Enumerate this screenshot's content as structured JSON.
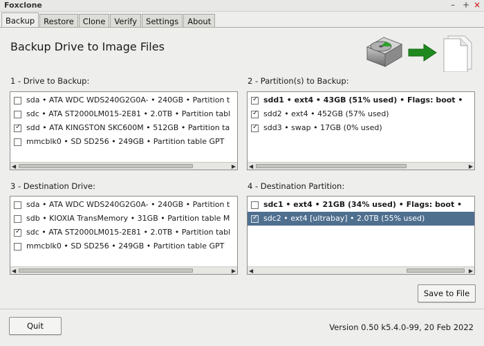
{
  "window": {
    "title": "Foxclone"
  },
  "tabs": [
    {
      "label": "Backup"
    },
    {
      "label": "Restore"
    },
    {
      "label": "Clone"
    },
    {
      "label": "Verify"
    },
    {
      "label": "Settings"
    },
    {
      "label": "About"
    }
  ],
  "page": {
    "heading": "Backup Drive to Image Files"
  },
  "drive_to_backup": {
    "label": "1 - Drive to Backup:",
    "items": [
      {
        "text": "sda • ATA WDC WDS240G2G0A- • 240GB • Partition t",
        "checked": false
      },
      {
        "text": "sdc • ATA ST2000LM015-2E81 • 2.0TB • Partition tabl",
        "checked": false
      },
      {
        "text": "sdd • ATA KINGSTON SKC600M • 512GB • Partition ta",
        "checked": true
      },
      {
        "text": "mmcblk0 • SD SD256 • 249GB • Partition table GPT",
        "checked": false
      }
    ]
  },
  "partitions_to_backup": {
    "label": "2 - Partition(s) to Backup:",
    "items": [
      {
        "text": "sdd1 • ext4 • 43GB (51% used) • Flags: boot •",
        "checked": true
      },
      {
        "text": "sdd2 • ext4 • 452GB (57% used)",
        "checked": true
      },
      {
        "text": "sdd3 • swap • 17GB (0% used)",
        "checked": true
      }
    ]
  },
  "destination_drive": {
    "label": "3 - Destination Drive:",
    "items": [
      {
        "text": "sda • ATA WDC WDS240G2G0A- • 240GB • Partition t",
        "checked": false
      },
      {
        "text": "sdb • KIOXIA TransMemory • 31GB • Partition table M",
        "checked": false
      },
      {
        "text": "sdc • ATA ST2000LM015-2E81 • 2.0TB • Partition tabl",
        "checked": true
      },
      {
        "text": "mmcblk0 • SD SD256 • 249GB • Partition table GPT",
        "checked": false
      }
    ]
  },
  "destination_partition": {
    "label": "4 - Destination Partition:",
    "items": [
      {
        "text": "sdc1 • ext4 • 21GB (34% used) • Flags: boot •",
        "checked": false
      },
      {
        "text": "sdc2 • ext4 [ultrabay] • 2.0TB (55% used)",
        "checked": true
      }
    ]
  },
  "buttons": {
    "save_to_file": "Save to File",
    "quit": "Quit"
  },
  "footer": {
    "version": "Version 0.50 k5.4.0-99, 20 Feb 2022"
  },
  "colors": {
    "selection": "#4f6f8f",
    "arrow": "#1f8a1f"
  }
}
